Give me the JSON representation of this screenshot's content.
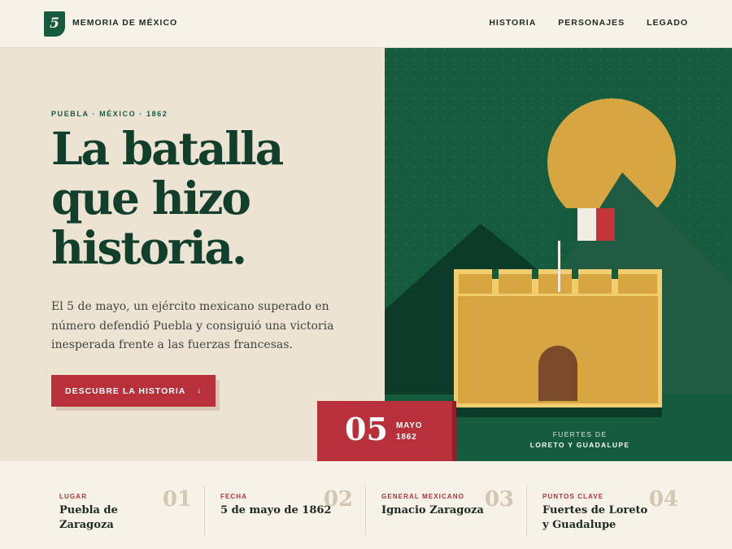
{
  "header": {
    "logo_text": "5",
    "brand": "MEMORIA DE MÉXICO",
    "nav": [
      "HISTORIA",
      "PERSONAJES",
      "LEGADO"
    ]
  },
  "hero": {
    "eyebrow": "PUEBLA · MÉXICO · 1862",
    "headline": [
      "La batalla",
      "que hizo",
      "historia."
    ],
    "lede": "El 5 de mayo, un ejército mexicano superado en número defendió Puebla y consiguió una victoria inesperada frente a las fuerzas francesas.",
    "cta_label": "DESCUBRE LA HISTORIA",
    "cta_icon": "arrow-down-icon",
    "cta_arrow": "↓"
  },
  "illustration": {
    "caption_line1": "FUERTES DE",
    "caption_line2": "LORETO Y GUADALUPE",
    "colors": {
      "background": "#155c3e",
      "sun": "#d7a640",
      "fort": "#d7a640",
      "door": "#7a4a2a",
      "flag_green": "#155c3e",
      "flag_white": "#f2ede2",
      "flag_red": "#c43539"
    }
  },
  "date_badge": {
    "day": "05",
    "month": "MAYO",
    "year": "1862"
  },
  "info_cards": [
    {
      "label": "LUGAR",
      "value": "Puebla de Zaragoza",
      "num": "01"
    },
    {
      "label": "FECHA",
      "value": "5 de mayo de 1862",
      "num": "02"
    },
    {
      "label": "GENERAL MEXICANO",
      "value": "Ignacio Zaragoza",
      "num": "03"
    },
    {
      "label": "PUNTOS CLAVE",
      "value": "Fuertes de Loreto y Guadalupe",
      "num": "04"
    }
  ],
  "colors": {
    "accent_green": "#155c3e",
    "accent_red": "#b8303a",
    "cream": "#f7f2e7",
    "sand": "#ede3d3"
  }
}
